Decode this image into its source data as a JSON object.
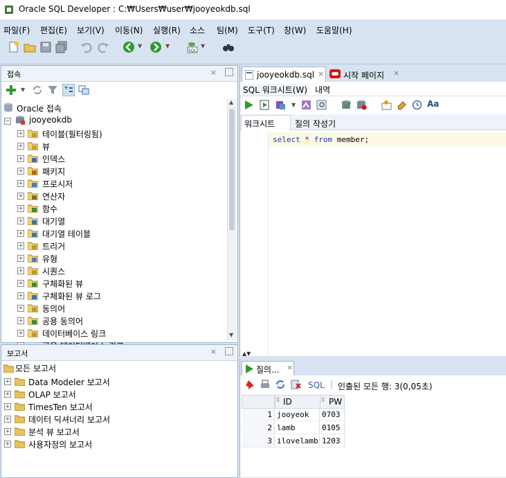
{
  "window": {
    "title": "Oracle SQL Developer : C:₩Users₩user₩jooyeokdb.sql"
  },
  "menu": [
    "파일(F)",
    "편집(E)",
    "보기(V)",
    "이동(N)",
    "실행(R)",
    "소스",
    "팀(M)",
    "도구(T)",
    "창(W)",
    "도움말(H)"
  ],
  "connections_panel": {
    "title": "접속",
    "root": "Oracle 접속",
    "db": "jooyeokdb",
    "items": [
      "테이블(필터링됨)",
      "뷰",
      "인덱스",
      "패키지",
      "프로시저",
      "연산자",
      "함수",
      "대기열",
      "대기열 테이블",
      "트리거",
      "유형",
      "시퀀스",
      "구체화된 뷰",
      "구체화된 뷰 로그",
      "동의어",
      "공용 동의어",
      "데이터베이스 링크",
      "공용 데이터베이스 링크"
    ]
  },
  "reports_panel": {
    "title": "보고서",
    "root": "모든 보고서",
    "items": [
      "Data Modeler 보고서",
      "OLAP 보고서",
      "TimesTen 보고서",
      "데이터 딕셔너리 보고서",
      "분석 뷰 보고서",
      "사용자정의 보고서"
    ]
  },
  "editor": {
    "tabs": [
      "jooyeokdb.sql",
      "시작 페이지"
    ],
    "subtabs": [
      "SQL 워크시트(W)",
      "내역"
    ],
    "inner_tabs": [
      "워크시트",
      "질의 작성기"
    ],
    "sql": {
      "kw1": "select",
      "star": "*",
      "kw2": "from",
      "rest": "member;"
    }
  },
  "result": {
    "tab": "질의...",
    "toolbar_sql": "SQL",
    "status": "인출된 모든 행: 3(0,05초)",
    "columns": [
      "ID",
      "PW"
    ],
    "rows": [
      {
        "n": "1",
        "id": "jooyeok",
        "pw": "0703"
      },
      {
        "n": "2",
        "id": "lamb",
        "pw": "0105"
      },
      {
        "n": "3",
        "id": "ilovelamb",
        "pw": "1203"
      }
    ]
  }
}
